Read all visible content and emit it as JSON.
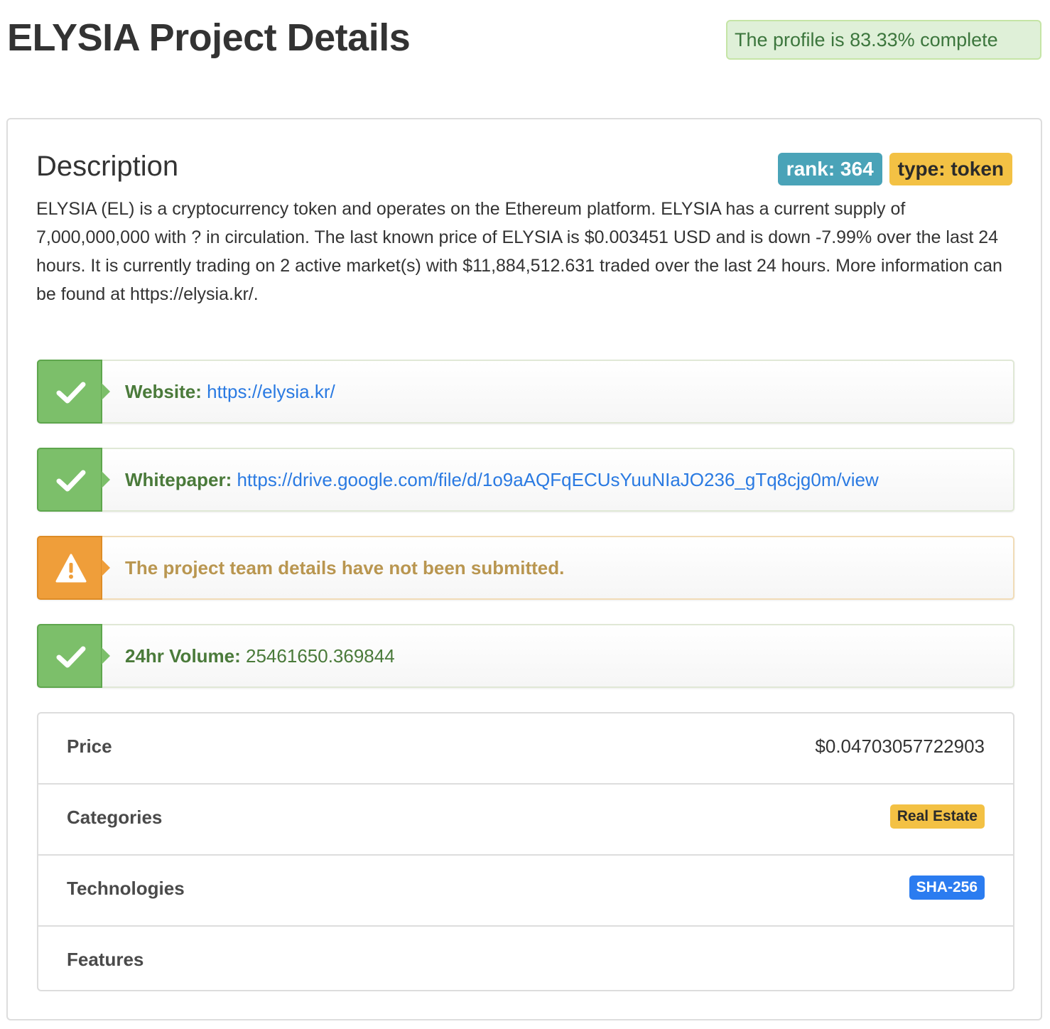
{
  "header": {
    "title": "ELYSIA Project Details",
    "profile_completion": "The profile is 83.33% complete"
  },
  "description_section": {
    "heading": "Description",
    "rank_label": "rank: 364",
    "type_label": "type: token",
    "text": "ELYSIA (EL) is a cryptocurrency token and operates on the Ethereum platform. ELYSIA has a current supply of 7,000,000,000 with ? in circulation. The last known price of ELYSIA is $0.003451 USD and is down -7.99% over the last 24 hours. It is currently trading on 2 active market(s) with $11,884,512.631 traded over the last 24 hours. More information can be found at https://elysia.kr/."
  },
  "checklist": {
    "website": {
      "label": "Website:",
      "link": "https://elysia.kr/",
      "status": "success",
      "icon": "check-icon"
    },
    "whitepaper": {
      "label": "Whitepaper:",
      "link": "https://drive.google.com/file/d/1o9aAQFqECUsYuuNIaJO236_gTq8cjg0m/view",
      "status": "success",
      "icon": "check-icon"
    },
    "team": {
      "message": "The project team details have not been submitted.",
      "status": "warning",
      "icon": "warning-icon"
    },
    "volume": {
      "label": "24hr Volume:",
      "value": "25461650.369844",
      "status": "success",
      "icon": "check-icon"
    }
  },
  "details": {
    "price_label": "Price",
    "price_value": "$0.04703057722903",
    "categories_label": "Categories",
    "categories": [
      "Real Estate"
    ],
    "technologies_label": "Technologies",
    "technologies": [
      "SHA-256"
    ],
    "features_label": "Features"
  },
  "colors": {
    "success": "#7cbf6a",
    "warning": "#ef9e3a",
    "rank_badge": "#4aa3b8",
    "type_badge": "#f3c144",
    "link": "#2a7ae2",
    "tech_tag": "#2b7cf0"
  }
}
